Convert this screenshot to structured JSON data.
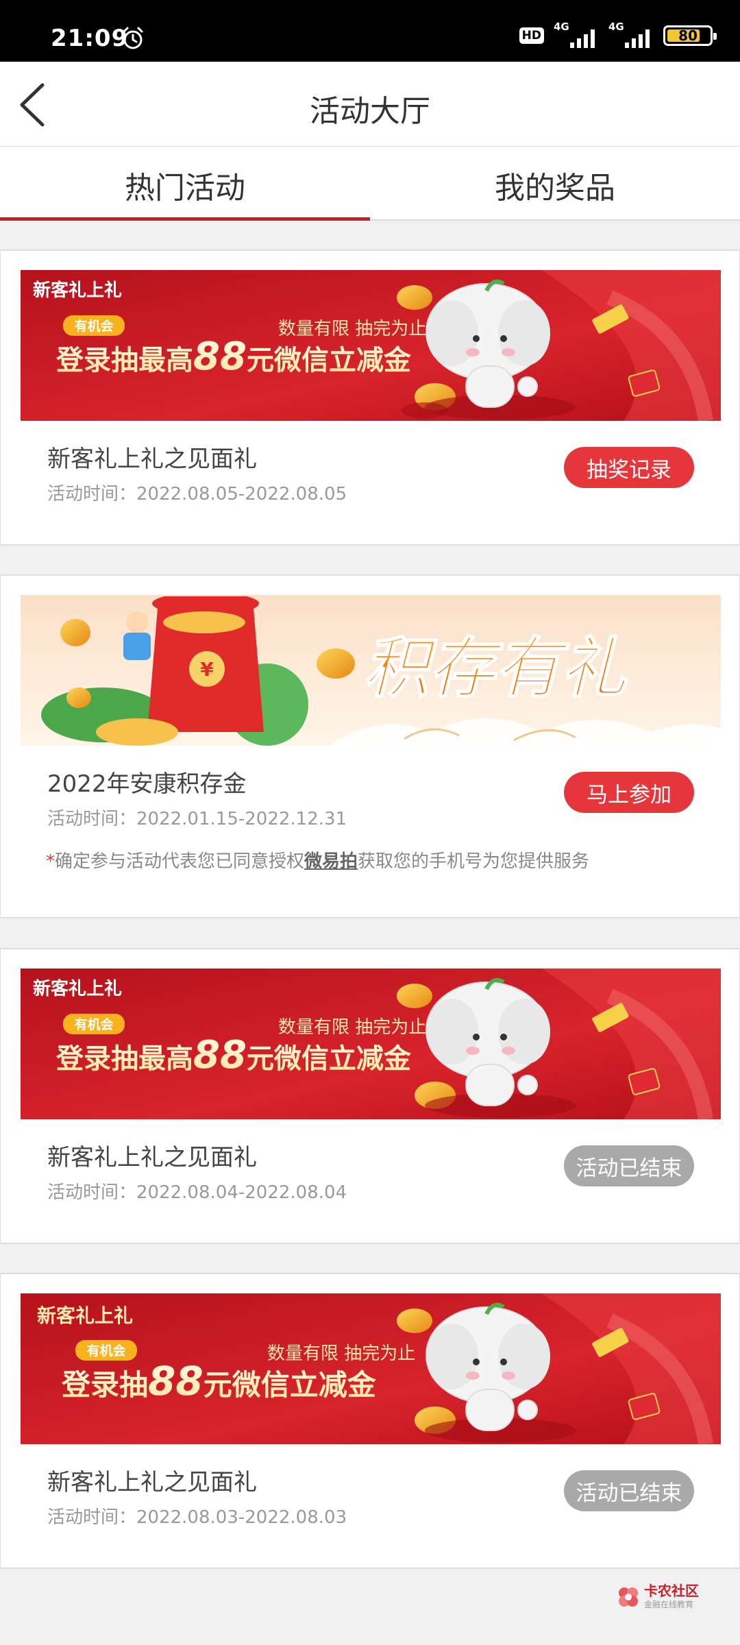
{
  "status_bar": {
    "time": "21:09",
    "hd_label": "HD",
    "net1": "4G",
    "net2": "4G",
    "battery_level": "80",
    "battery_color": "#f2c531",
    "icons": [
      "alarm-icon",
      "signal-icon",
      "battery-icon"
    ]
  },
  "header": {
    "title": "活动大厅",
    "back_icon": "chevron-left-icon"
  },
  "tabs": [
    {
      "label": "热门活动",
      "active": true
    },
    {
      "label": "我的奖品",
      "active": false
    }
  ],
  "colors": {
    "accent": "#c8202a",
    "pill_red": "#e5363c",
    "pill_gray": "#a9a9a9"
  },
  "activities": [
    {
      "banner": {
        "brand": "新客礼上礼",
        "chance_badge": "有机会",
        "limit_text": "数量有限 抽完为止",
        "headline_pre": "登录抽最高",
        "headline_num": "88",
        "headline_post": "元微信立减金"
      },
      "title": "新客礼上礼之见面礼",
      "time": "活动时间：2022.08.05-2022.08.05",
      "button": "抽奖记录",
      "button_state": "active"
    },
    {
      "banner": {
        "headline": "积存有礼",
        "coin_symbol": "¥"
      },
      "title": "2022年安康积存金",
      "time": "活动时间：2022.01.15-2022.12.31",
      "button": "马上参加",
      "button_state": "active",
      "notice_star": "*",
      "notice_pre": "确定参与活动代表您已同意授权",
      "notice_app": "微易拍",
      "notice_post": "获取您的手机号为您提供服务"
    },
    {
      "banner": {
        "brand": "新客礼上礼",
        "chance_badge": "有机会",
        "limit_text": "数量有限 抽完为止",
        "headline_pre": "登录抽最高",
        "headline_num": "88",
        "headline_post": "元微信立减金"
      },
      "title": "新客礼上礼之见面礼",
      "time": "活动时间：2022.08.04-2022.08.04",
      "button": "活动已结束",
      "button_state": "ended"
    },
    {
      "banner": {
        "brand": "新客礼上礼",
        "chance_badge": "有机会",
        "limit_text": "数量有限 抽完为止",
        "headline_pre": "登录抽",
        "headline_num": "88",
        "headline_post": "元微信立减金"
      },
      "title": "新客礼上礼之见面礼",
      "time": "活动时间：2022.08.03-2022.08.03",
      "button": "活动已结束",
      "button_state": "ended"
    }
  ],
  "watermark": {
    "text": "卡农社区",
    "sub": "金融在线教育"
  }
}
